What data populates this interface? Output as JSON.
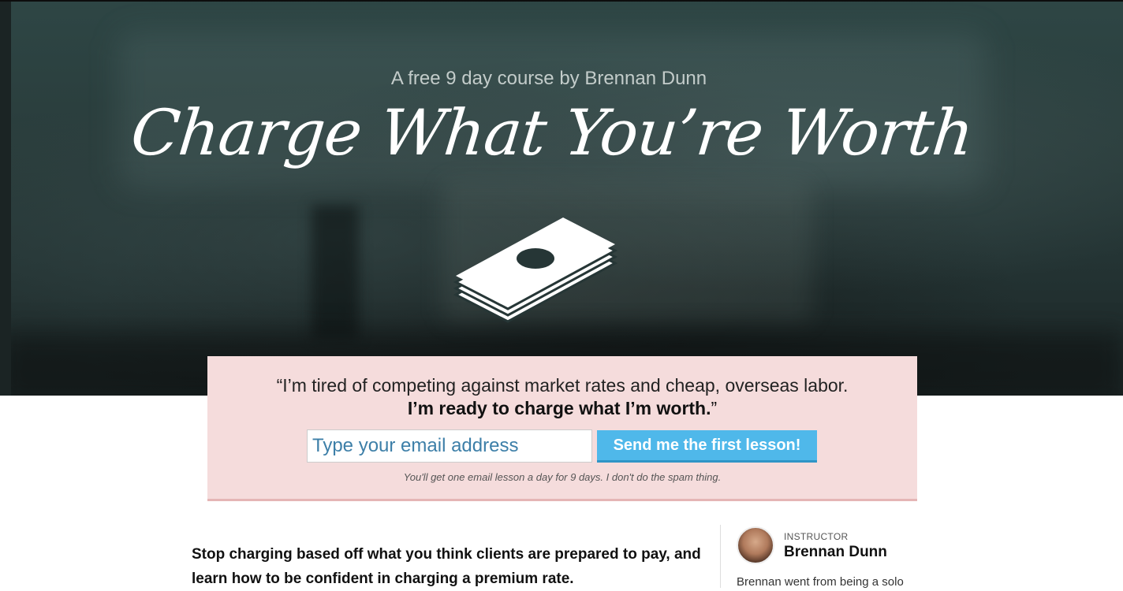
{
  "hero": {
    "subtitle": "A free 9 day course by Brennan Dunn",
    "title": "Charge What You’re Worth"
  },
  "signup": {
    "quote_line1": "“I’m tired of competing against market rates and cheap, overseas labor.",
    "quote_line2_bold": "I’m ready to charge what I’m worth.",
    "quote_line2_end": "”",
    "email_placeholder": "Type your email address",
    "submit_label": "Send me the first lesson!",
    "note": "You'll get one email lesson a day for 9 days. I don't do the spam thing."
  },
  "content": {
    "intro": "Stop charging based off what you think clients are prepared to pay, and learn how to be confident in charging a premium rate."
  },
  "instructor": {
    "label": "INSTRUCTOR",
    "name": "Brennan Dunn",
    "bio_snippet": "Brennan went from being a solo"
  },
  "icons": {
    "money": "money-stack-icon"
  },
  "colors": {
    "signup_bg": "#f5dcdc",
    "button": "#4fb8ea",
    "placeholder": "#3d7fa8"
  }
}
